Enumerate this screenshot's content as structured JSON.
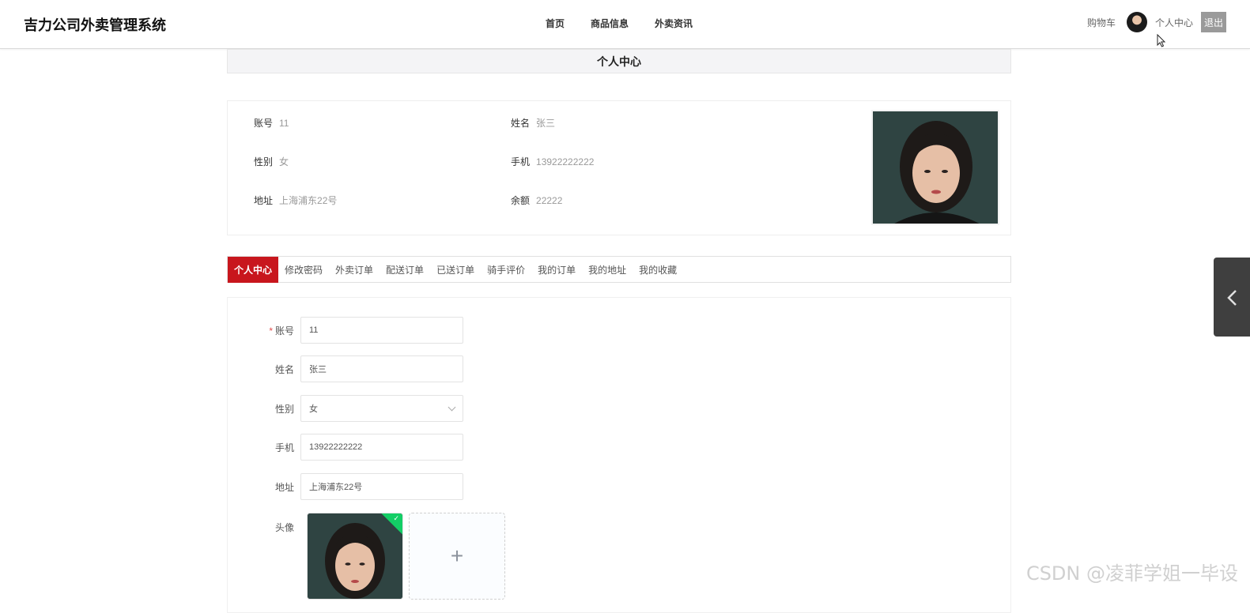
{
  "header": {
    "title": "吉力公司外卖管理系统",
    "nav": [
      "首页",
      "商品信息",
      "外卖资讯"
    ],
    "cart": "购物车",
    "user_center": "个人中心",
    "logout": "退出"
  },
  "page_title": "个人中心",
  "profile": {
    "account_label": "账号",
    "account_value": "11",
    "name_label": "姓名",
    "name_value": "张三",
    "gender_label": "性别",
    "gender_value": "女",
    "phone_label": "手机",
    "phone_value": "13922222222",
    "address_label": "地址",
    "address_value": "上海浦东22号",
    "balance_label": "余额",
    "balance_value": "22222"
  },
  "tabs": [
    "个人中心",
    "修改密码",
    "外卖订单",
    "配送订单",
    "已送订单",
    "骑手评价",
    "我的订单",
    "我的地址",
    "我的收藏"
  ],
  "form": {
    "required_mark": "*",
    "account_label": "账号",
    "account_value": "11",
    "name_label": "姓名",
    "name_value": "张三",
    "gender_label": "性别",
    "gender_value": "女",
    "phone_label": "手机",
    "phone_value": "13922222222",
    "address_label": "地址",
    "address_value": "上海浦东22号",
    "avatar_label": "头像",
    "add_symbol": "+"
  },
  "watermark": "CSDN @凌菲学姐一毕设",
  "colors": {
    "accent": "#c8161d",
    "success": "#13ce66"
  }
}
